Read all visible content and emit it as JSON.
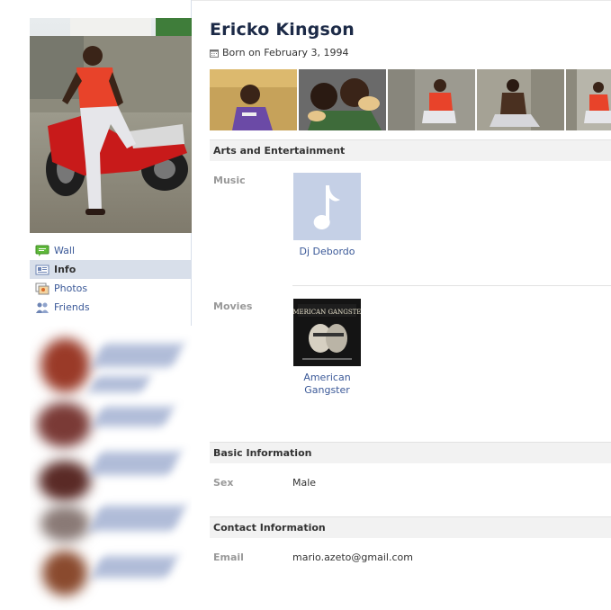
{
  "profile": {
    "name": "Ericko Kingson",
    "born": "Born on February 3, 1994"
  },
  "nav": {
    "items": [
      {
        "label": "Wall",
        "icon": "wall-icon"
      },
      {
        "label": "Info",
        "icon": "info-icon",
        "active": true
      },
      {
        "label": "Photos",
        "icon": "photos-icon"
      },
      {
        "label": "Friends",
        "icon": "friends-icon"
      }
    ]
  },
  "sections": {
    "arts": {
      "title": "Arts and Entertainment",
      "music": {
        "label": "Music",
        "item": "Dj Debordo"
      },
      "movies": {
        "label": "Movies",
        "item_line1": "American",
        "item_line2": "Gangster",
        "poster_title": "AMERICAN GANGSTER"
      }
    },
    "basic": {
      "title": "Basic Information",
      "sex_label": "Sex",
      "sex_value": "Male"
    },
    "contact": {
      "title": "Contact Information",
      "email_label": "Email",
      "email_value": "mario.azeto@gmail.com"
    }
  },
  "colors": {
    "link": "#3b5998",
    "name": "#1c2a47",
    "nav_active_bg": "#d8dfea",
    "section_bg": "#f2f2f2",
    "music_tile": "#c5d0e6"
  }
}
